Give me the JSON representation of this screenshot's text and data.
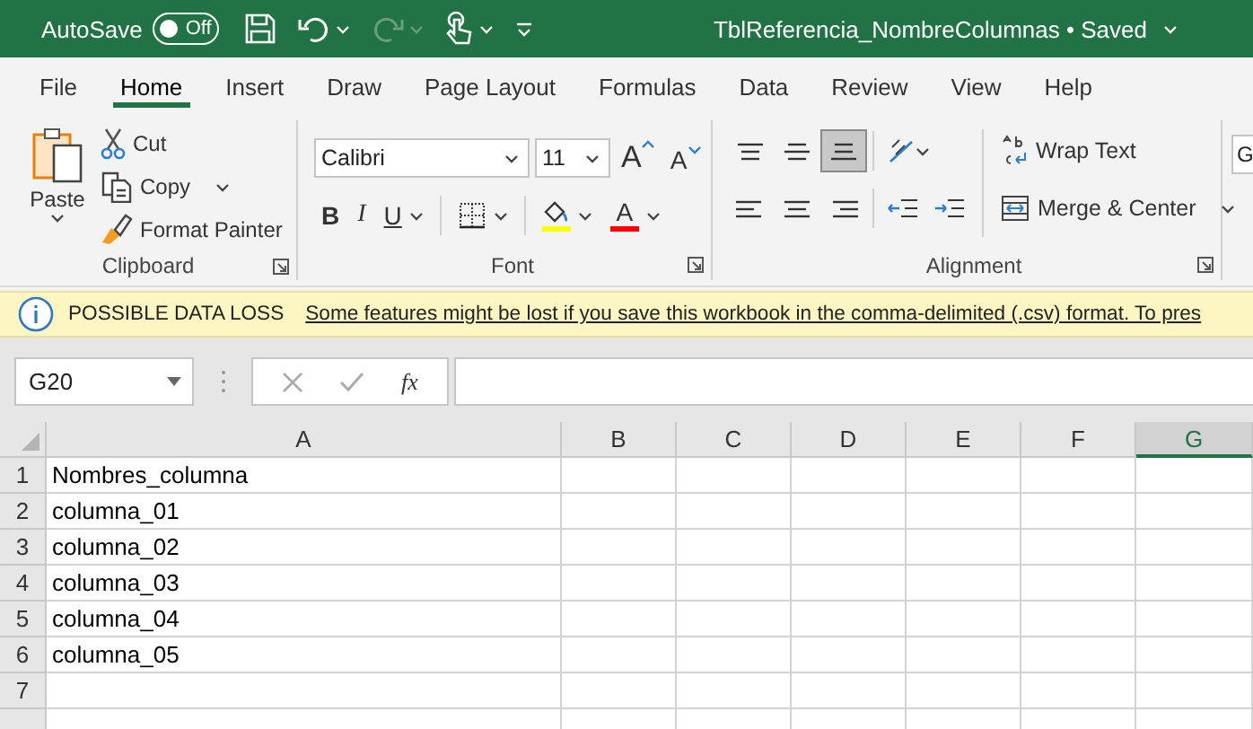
{
  "title_bar": {
    "autosave": {
      "label": "AutoSave",
      "state_label": "Off",
      "on": false
    },
    "quick_access": [
      {
        "kind": "save",
        "has_menu": false,
        "disabled": false
      },
      {
        "kind": "undo",
        "has_menu": true,
        "disabled": false
      },
      {
        "kind": "redo",
        "has_menu": true,
        "disabled": true
      },
      {
        "kind": "touch",
        "has_menu": true,
        "disabled": false
      },
      {
        "kind": "customize",
        "has_menu": false,
        "disabled": false
      }
    ],
    "title": "TblReferencia_NombreColumnas • Saved"
  },
  "menu_tabs": [
    {
      "label": "File",
      "selected": false
    },
    {
      "label": "Home",
      "selected": true
    },
    {
      "label": "Insert",
      "selected": false
    },
    {
      "label": "Draw",
      "selected": false
    },
    {
      "label": "Page Layout",
      "selected": false
    },
    {
      "label": "Formulas",
      "selected": false
    },
    {
      "label": "Data",
      "selected": false
    },
    {
      "label": "Review",
      "selected": false
    },
    {
      "label": "View",
      "selected": false
    },
    {
      "label": "Help",
      "selected": false
    }
  ],
  "ribbon": {
    "clipboard": {
      "label": "Clipboard",
      "paste": "Paste",
      "items": [
        {
          "kind": "cut",
          "label": "Cut",
          "has_menu": false
        },
        {
          "kind": "copy",
          "label": "Copy",
          "has_menu": true
        },
        {
          "kind": "painter",
          "label": "Format Painter",
          "has_menu": false
        }
      ]
    },
    "font": {
      "label": "Font",
      "font_name": "Calibri",
      "font_size": "11",
      "size_buttons": [
        {
          "kind": "grow",
          "label": "A"
        },
        {
          "kind": "shrink",
          "label": "A"
        }
      ],
      "format_buttons": [
        {
          "kind": "bold",
          "label": "B",
          "has_menu": false
        },
        {
          "kind": "italic",
          "label": "I",
          "has_menu": false
        },
        {
          "kind": "underline",
          "label": "U",
          "has_menu": true
        }
      ],
      "font_color_label": "A"
    },
    "alignment": {
      "label": "Alignment",
      "vertical": [
        {
          "kind": "top",
          "selected": false
        },
        {
          "kind": "middle",
          "selected": false
        },
        {
          "kind": "bottom",
          "selected": true
        }
      ],
      "horizontal": [
        {
          "kind": "left",
          "selected": false
        },
        {
          "kind": "center",
          "selected": false
        },
        {
          "kind": "right",
          "selected": false
        }
      ],
      "wrap_text": "Wrap Text",
      "merge": "Merge & Center"
    },
    "number": {
      "format": "G"
    }
  },
  "message_bar": {
    "title": "POSSIBLE DATA LOSS",
    "message": "Some features might be lost if you save this workbook in the comma-delimited (.csv) format. To pres"
  },
  "formula_bar": {
    "name_box": "G20",
    "insert_function": "fx"
  },
  "sheet": {
    "columns": [
      {
        "label": "A",
        "selected": false
      },
      {
        "label": "B",
        "selected": false
      },
      {
        "label": "C",
        "selected": false
      },
      {
        "label": "D",
        "selected": false
      },
      {
        "label": "E",
        "selected": false
      },
      {
        "label": "F",
        "selected": false
      },
      {
        "label": "G",
        "selected": true
      }
    ],
    "rows": [
      {
        "number": "1",
        "cells": [
          "Nombres_columna"
        ]
      },
      {
        "number": "2",
        "cells": [
          "columna_01"
        ]
      },
      {
        "number": "3",
        "cells": [
          "columna_02"
        ]
      },
      {
        "number": "4",
        "cells": [
          "columna_03"
        ]
      },
      {
        "number": "5",
        "cells": [
          "columna_04"
        ]
      },
      {
        "number": "6",
        "cells": [
          "columna_05"
        ]
      },
      {
        "number": "7"
      }
    ]
  }
}
